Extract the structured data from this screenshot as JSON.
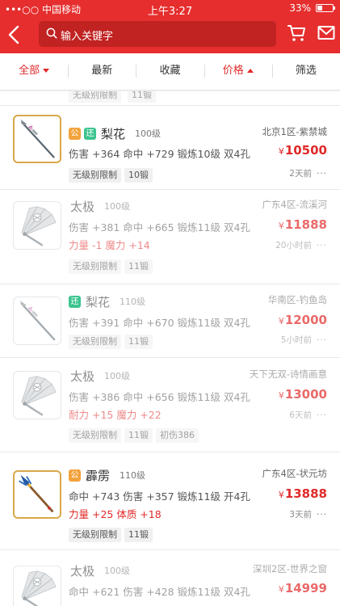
{
  "status_bar": {
    "carrier": "•••○○ 中国移动",
    "time": "上午3:27",
    "battery": "33%",
    "battery_level": 0.33
  },
  "header": {
    "search_placeholder": "输入关键字"
  },
  "tabs": [
    {
      "label": "全部",
      "indicator": "down",
      "active": true
    },
    {
      "label": "最新"
    },
    {
      "label": "收藏"
    },
    {
      "label": "价格",
      "indicator": "up",
      "active": true
    },
    {
      "label": "筛选"
    }
  ],
  "peek": {
    "tags": [
      "无级别限制",
      "11锻"
    ]
  },
  "items": [
    {
      "badges": [
        {
          "text": "公",
          "color": "#f2a23c"
        },
        {
          "text": "还",
          "color": "#3cc48f"
        }
      ],
      "title": "梨花",
      "level": "100级",
      "stats": "伤害 +364 命中 +729 锻炼10级 双4孔",
      "bonus": "",
      "tags": [
        "无级别限制",
        "10锻"
      ],
      "server": "北京1区-紫禁城",
      "currency": "¥",
      "price": "10500",
      "time": "2天前",
      "more": "···",
      "icon": "spear-icon",
      "faded": false
    },
    {
      "badges": [],
      "title": "太极",
      "level": "100级",
      "stats": "伤害 +381 命中 +665 锻炼11级 双4孔",
      "bonus": "力量 -1 魔力 +14",
      "tags": [
        "无级别限制",
        "11锻"
      ],
      "server": "广东4区-流溪河",
      "currency": "¥",
      "price": "11888",
      "time": "20小时前",
      "more": "···",
      "icon": "fan-icon",
      "faded": true
    },
    {
      "badges": [
        {
          "text": "还",
          "color": "#3cc48f"
        }
      ],
      "title": "梨花",
      "level": "110级",
      "stats": "伤害 +391 命中 +670 锻炼11级 双4孔",
      "bonus": "",
      "tags": [
        "无级别限制",
        "11锻"
      ],
      "server": "华南区-钓鱼岛",
      "currency": "¥",
      "price": "12000",
      "time": "5小时前",
      "more": "···",
      "icon": "spear-icon",
      "faded": true
    },
    {
      "badges": [],
      "title": "太极",
      "level": "100级",
      "stats": "伤害 +386 命中 +656 锻炼11级 双4孔",
      "bonus": "耐力 +15 魔力 +22",
      "tags": [
        "无级别限制",
        "11锻",
        "初伤386"
      ],
      "server": "天下无双-诗情画意",
      "currency": "¥",
      "price": "13000",
      "time": "6天前",
      "more": "···",
      "icon": "fan-icon",
      "faded": true
    },
    {
      "badges": [
        {
          "text": "公",
          "color": "#f2a23c"
        }
      ],
      "title": "霹雳",
      "level": "110级",
      "stats": "命中 +743 伤害 +357 锻炼11级 开4孔",
      "bonus": "力量 +25 体质 +18",
      "tags": [
        "无级别限制",
        "11锻"
      ],
      "server": "广东4区-状元坊",
      "currency": "¥",
      "price": "13888",
      "time": "3天前",
      "more": "···",
      "icon": "trident-icon",
      "faded": false
    },
    {
      "badges": [],
      "title": "太极",
      "level": "100级",
      "stats": "命中 +621 伤害 +428 锻炼11级 双4孔",
      "bonus": "",
      "tags": [],
      "server": "深圳2区-世界之窗",
      "currency": "¥",
      "price": "14999",
      "time": "",
      "more": "",
      "icon": "fan-icon",
      "faded": true
    }
  ]
}
